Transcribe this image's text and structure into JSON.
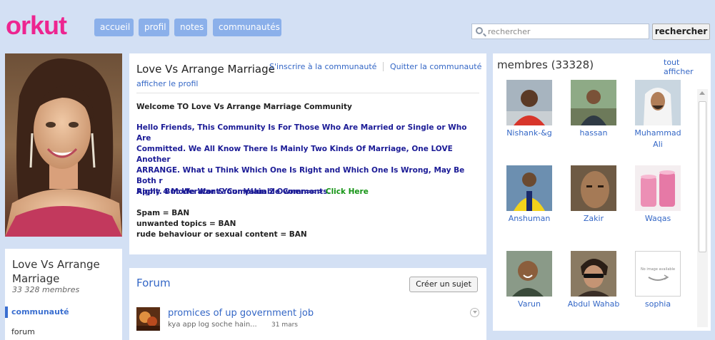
{
  "header": {
    "logo": "orkut",
    "nav": [
      "accueil",
      "profil",
      "notes",
      "communautés"
    ],
    "search_placeholder": "rechercher",
    "search_button": "rechercher"
  },
  "sidebar": {
    "community_name": "Love Vs Arrange Marriage",
    "member_count": "33 328 membres",
    "nav_community": "communauté",
    "nav_forum": "forum"
  },
  "community": {
    "title": "Love Vs Arrange Marriage",
    "join_link": "S'inscrire à la communauté",
    "quit_link": "Quitter la communauté",
    "profile_link": "afficher le profil",
    "welcome": "Welcome TO Love Vs Arrange Marriage Community",
    "body_lines": [
      "Hello Friends, This Community Is For Those Who Are Married or Single or Who Are",
      "Committed. We All Know There Is Mainly Two Kinds Of Marriage, One LOVE Another",
      "ARRANGE. What u Think Which One Is Right and Which One Is Wrong, May Be Both r",
      "Right. But We Want Your Valuable Comments."
    ],
    "apply_text": "Apply 4 Moderator & Complain 2 Owner==> ",
    "apply_link": "Click Here",
    "rules": [
      "Spam = BAN",
      "unwanted topics = BAN",
      "rude behaviour or sexual content = BAN"
    ]
  },
  "forum": {
    "title": "Forum",
    "new_topic_button": "Créer un sujet",
    "topics": [
      {
        "title": "promices of up government job",
        "snippet": "kya app log soche hain...",
        "date": "31 mars"
      }
    ]
  },
  "members": {
    "title": "membres (33328)",
    "see_all": "tout afficher",
    "list": [
      {
        "name": "Nishank-&g",
        "icon": "photo-red-shirt-man"
      },
      {
        "name": "hassan",
        "icon": "photo-man-outdoor"
      },
      {
        "name": "Muhammad Ali",
        "icon": "photo-man-white-headdress"
      },
      {
        "name": "Anshuman",
        "icon": "photo-man-yellow-jacket"
      },
      {
        "name": "Zakir",
        "icon": "photo-man-closeup"
      },
      {
        "name": "Waqas",
        "icon": "photo-pink-candles"
      },
      {
        "name": "Varun",
        "icon": "photo-man-smiling"
      },
      {
        "name": "Abdul Wahab",
        "icon": "photo-man-sunglasses"
      },
      {
        "name": "sophia",
        "icon": "no-image-placeholder",
        "placeholder_text": "No image available"
      }
    ]
  },
  "colors": {
    "background": "#d3e0f4",
    "brand_pink": "#ed2590",
    "nav_button": "#8bb0ea",
    "link_blue": "#3467c6",
    "description_navy": "#1b1b96",
    "click_here_green": "#159415"
  }
}
